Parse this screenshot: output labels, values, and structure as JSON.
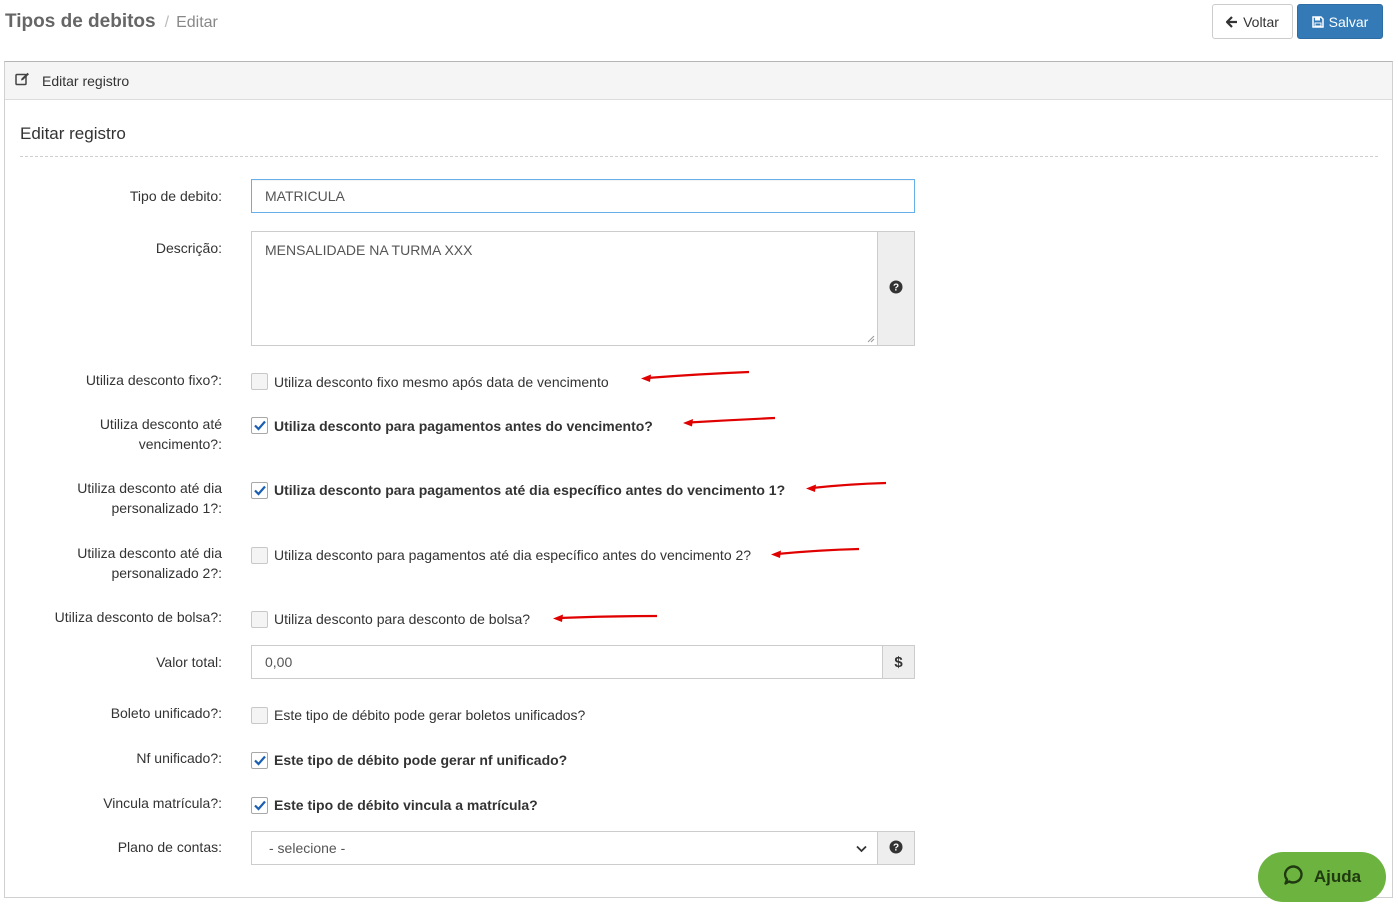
{
  "breadcrumb": {
    "title": "Tipos de debitos",
    "separator": "/",
    "current": "Editar"
  },
  "toolbar": {
    "back_label": "Voltar",
    "save_label": "Salvar"
  },
  "panel": {
    "header": "Editar registro",
    "section_title": "Editar registro"
  },
  "form": {
    "tipo_label": "Tipo de debito:",
    "tipo_value": "MATRICULA",
    "descricao_label": "Descrição:",
    "descricao_value": "MENSALIDADE NA TURMA XXX",
    "desconto_fixo": {
      "label": "Utiliza desconto fixo?:",
      "text": "Utiliza desconto fixo mesmo após data de vencimento",
      "checked": false
    },
    "desconto_vencimento": {
      "label_1": "Utiliza desconto até",
      "label_2": "vencimento?:",
      "text": "Utiliza desconto para pagamentos antes do vencimento?",
      "checked": true
    },
    "desconto_dia_1": {
      "label_1": "Utiliza desconto até dia",
      "label_2": "personalizado 1?:",
      "text": "Utiliza desconto para pagamentos até dia específico antes do vencimento 1?",
      "checked": true
    },
    "desconto_dia_2": {
      "label_1": "Utiliza desconto até dia",
      "label_2": "personalizado 2?:",
      "text": "Utiliza desconto para pagamentos até dia específico antes do vencimento 2?",
      "checked": false
    },
    "desconto_bolsa": {
      "label": "Utiliza desconto de bolsa?:",
      "text": "Utiliza desconto para desconto de bolsa?",
      "checked": false
    },
    "valor_label": "Valor total:",
    "valor_value": "0,00",
    "valor_addon": "$",
    "boleto": {
      "label": "Boleto unificado?:",
      "text": "Este tipo de débito pode gerar boletos unificados?",
      "checked": false
    },
    "nf": {
      "label": "Nf unificado?:",
      "text": "Este tipo de débito pode gerar nf unificado?",
      "checked": true
    },
    "vincula": {
      "label": "Vincula matrícula?:",
      "text": "Este tipo de débito vincula a matrícula?",
      "checked": true
    },
    "plano_label": "Plano de contas:",
    "plano_selected": "- selecione -"
  },
  "help": {
    "label": "Ajuda"
  },
  "colors": {
    "primary": "#337ab7",
    "help_green": "#6db33f",
    "annotation_red": "#e00000",
    "check_blue": "#1a5fb4"
  },
  "icons": [
    "arrow-left-icon",
    "floppy-disk-icon",
    "edit-icon",
    "question-circle-icon",
    "dollar-icon",
    "chevron-down-icon",
    "chat-bubble-icon",
    "red-arrow-annotation"
  ]
}
